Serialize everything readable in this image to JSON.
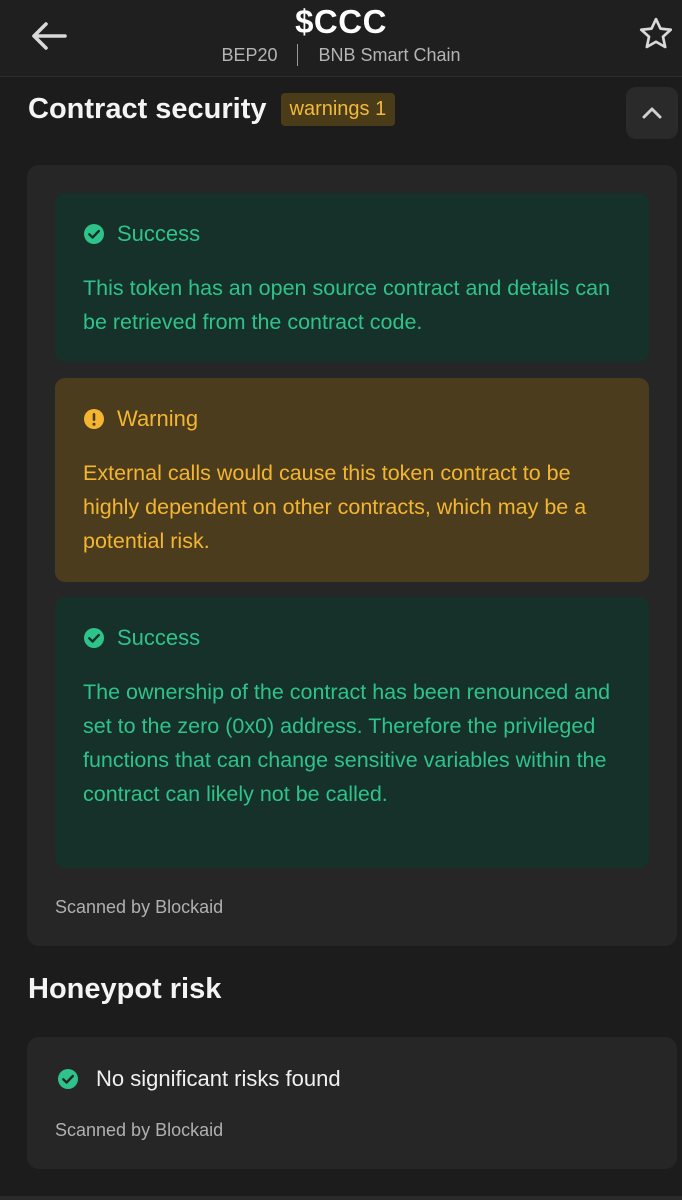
{
  "header": {
    "title": "$CCC",
    "standard": "BEP20",
    "chain": "BNB Smart Chain",
    "back_icon": "arrow-left-icon",
    "favorite_icon": "star-icon"
  },
  "contract_security": {
    "title": "Contract security",
    "badge": "warnings 1",
    "collapse_icon": "chevron-up-icon",
    "alerts": [
      {
        "status": "Success",
        "icon": "check-circle-icon",
        "text": "This token has an open source contract and details can be retrieved from the contract code."
      },
      {
        "status": "Warning",
        "icon": "exclamation-circle-icon",
        "text": "External calls would cause this token contract to be highly dependent on other contracts, which may be a potential risk."
      },
      {
        "status": "Success",
        "icon": "check-circle-icon",
        "text": "The ownership of the contract has been renounced and set to the zero (0x0) address. Therefore the privileged functions that can change sensitive variables within the contract can likely not be called."
      }
    ],
    "scanned_by": "Scanned by Blockaid"
  },
  "honeypot": {
    "title": "Honeypot risk",
    "result": "No significant risks found",
    "icon": "check-circle-icon",
    "scanned_by": "Scanned by Blockaid"
  },
  "colors": {
    "background": "#1c1c1c",
    "panel": "#262626",
    "success_bg": "#16302a",
    "success_text": "#2ec38b",
    "warning_bg": "#4b3c1d",
    "warning_text": "#f4b531"
  }
}
